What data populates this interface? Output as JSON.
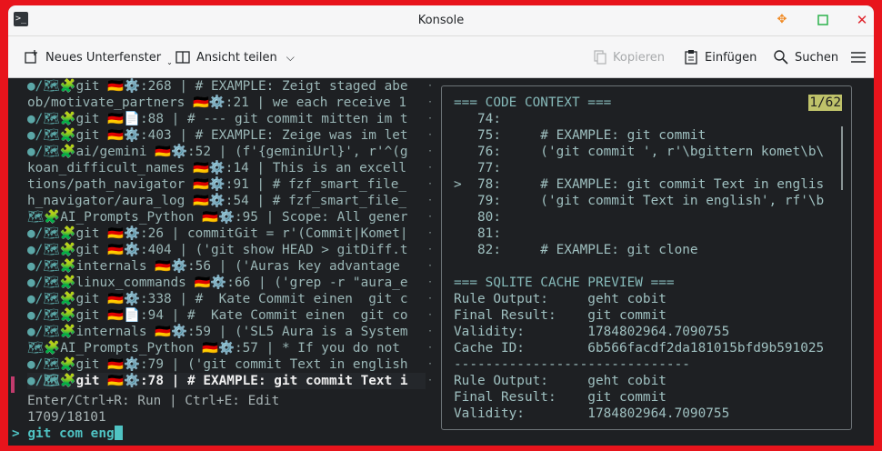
{
  "window": {
    "title": "Konsole"
  },
  "toolbar": {
    "new_tab": "Neues Unterfenster",
    "split_view": "Ansicht teilen",
    "copy": "Kopieren",
    "paste": "Einfügen",
    "find": "Suchen"
  },
  "results": [
    {
      "prefix": "●/🗺🧩",
      "text": "git 🇩🇪⚙️:268 | # EXAMPLE: Zeigt staged abe"
    },
    {
      "prefix": "",
      "text": "ob/motivate_partners 🇩🇪⚙️:21 | we each receive 1"
    },
    {
      "prefix": "●/🗺🧩",
      "text": "git 🇩🇪📄:88 | # --- git commit mitten im t"
    },
    {
      "prefix": "●/🗺🧩",
      "text": "git 🇩🇪⚙️:403 | # EXAMPLE: Zeige was im let"
    },
    {
      "prefix": "●/🗺🧩",
      "text": "ai/gemini 🇩🇪⚙️:52 | (f'{geminiUrl}', r'^(g"
    },
    {
      "prefix": "",
      "text": "koan_difficult_names 🇩🇪⚙️:14 | This is an excell"
    },
    {
      "prefix": "",
      "text": "tions/path_navigator 🇩🇪⚙️:91 | # fzf_smart_file_"
    },
    {
      "prefix": "",
      "text": "h_navigator/aura_log 🇩🇪⚙️:54 | # fzf_smart_file_"
    },
    {
      "prefix": "🗺🧩",
      "text": "AI_Prompts_Python 🇩🇪⚙️:95 | Scope: All gener"
    },
    {
      "prefix": "●/🗺🧩",
      "text": "git 🇩🇪⚙️:26 | commitGit = r'(Commit|Komet|"
    },
    {
      "prefix": "●/🗺🧩",
      "text": "git 🇩🇪⚙️:404 | ('git show HEAD > gitDiff.t"
    },
    {
      "prefix": "●/🗺🧩",
      "text": "internals 🇩🇪⚙️:56 | ('Auras key advantage"
    },
    {
      "prefix": "●/🗺🧩",
      "text": "linux_commands 🇩🇪⚙️:66 | ('grep -r \"aura_e"
    },
    {
      "prefix": "●/🗺🧩",
      "text": "git 🇩🇪⚙️:338 | #  Kate Commit einen  git c"
    },
    {
      "prefix": "●/🗺🧩",
      "text": "git 🇩🇪📄:94 | #  Kate Commit einen  git co"
    },
    {
      "prefix": "●/🗺🧩",
      "text": "internals 🇩🇪⚙️:59 | ('SL5 Aura is a System"
    },
    {
      "prefix": "🗺🧩",
      "text": "AI_Prompts_Python 🇩🇪⚙️:57 | * If you do not"
    },
    {
      "prefix": "●/🗺🧩",
      "text": "git 🇩🇪⚙️:79 | ('git commit Text in english"
    },
    {
      "prefix": "●/🗺🧩",
      "text": "git 🇩🇪⚙️:78 | # EXAMPLE: git commit Text i"
    }
  ],
  "help_line": "Enter/Ctrl+R: Run | Ctrl+E: Edit",
  "count_line": "1709/18101",
  "prompt": {
    "symbol": ">",
    "query": "git com eng"
  },
  "preview": {
    "counter": "1/62",
    "lines": [
      "=== CODE CONTEXT ===",
      "   74:",
      "   75:     # EXAMPLE: git commit",
      "   76:     ('git commit ', r'\\bgittern komet\\b\\",
      "   77:",
      ">  78:     # EXAMPLE: git commit Text in englis",
      "   79:     ('git commit Text in english', rf'\\b",
      "   80:",
      "   81:",
      "   82:     # EXAMPLE: git clone",
      "",
      "=== SQLITE CACHE PREVIEW ===",
      "Rule Output:     geht cobit",
      "Final Result:    git commit",
      "Validity:        1784802964.7090755",
      "Cache ID:        6b566facdf2da181015bfd9b591025",
      "------------------------------",
      "Rule Output:     geht cobit",
      "Final Result:    git commit",
      "Validity:        1784802964.7090755"
    ]
  },
  "colors": {
    "accent": "#c23b6d",
    "prompt": "#4fc3c3",
    "counter_bg": "#bfc26a"
  }
}
